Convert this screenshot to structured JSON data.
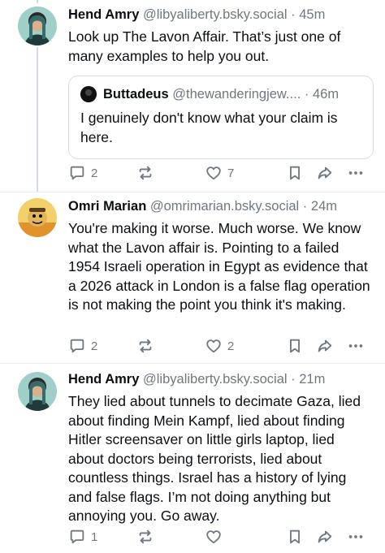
{
  "posts": [
    {
      "name": "Hend Amry",
      "handle": "@libyaliberty.bsky.social",
      "dot": "·",
      "time": "45m",
      "text": "Look up The Lavon Affair. That’s just one of many examples to help you out.",
      "quote": {
        "name": "Buttadeus",
        "handle": "@thewanderingjew....",
        "dot": "·",
        "time": "46m",
        "text": "I genuinely don't know what your claim is here."
      },
      "replies": "2",
      "reposts": "",
      "likes": "7"
    },
    {
      "name": "Omri Marian",
      "handle": "@omrimarian.bsky.social",
      "dot": "·",
      "time": "24m",
      "text": "You're making it worse. Much worse. We know what the Lavon affair is. Pointing to a failed  1954 Israeli operation in Egypt as evidence that a 2026 attack in London is a false flag operation is not making the point you think it's making.",
      "replies": "2",
      "reposts": "",
      "likes": "2"
    },
    {
      "name": "Hend Amry",
      "handle": "@libyaliberty.bsky.social",
      "dot": "·",
      "time": "21m",
      "text": "They lied about tunnels to decimate Gaza, lied about finding Mein Kampf, lied about finding Hitler screensaver on little girls laptop, lied about doctors being terrorists, lied about countless things. Israel has a history of lying and false flags. I’m not doing anything but annoying you. Go away.",
      "replies": "1",
      "reposts": "",
      "likes": ""
    }
  ],
  "icons": {
    "reply": "reply-icon",
    "repost": "repost-icon",
    "like": "heart-icon",
    "bookmark": "bookmark-icon",
    "share": "share-icon",
    "more": "more-icon"
  },
  "colors": {
    "text": "#0b0f14",
    "muted": "#6f7780",
    "thread_line": "#d4dbe2",
    "border": "#d7dde3"
  }
}
